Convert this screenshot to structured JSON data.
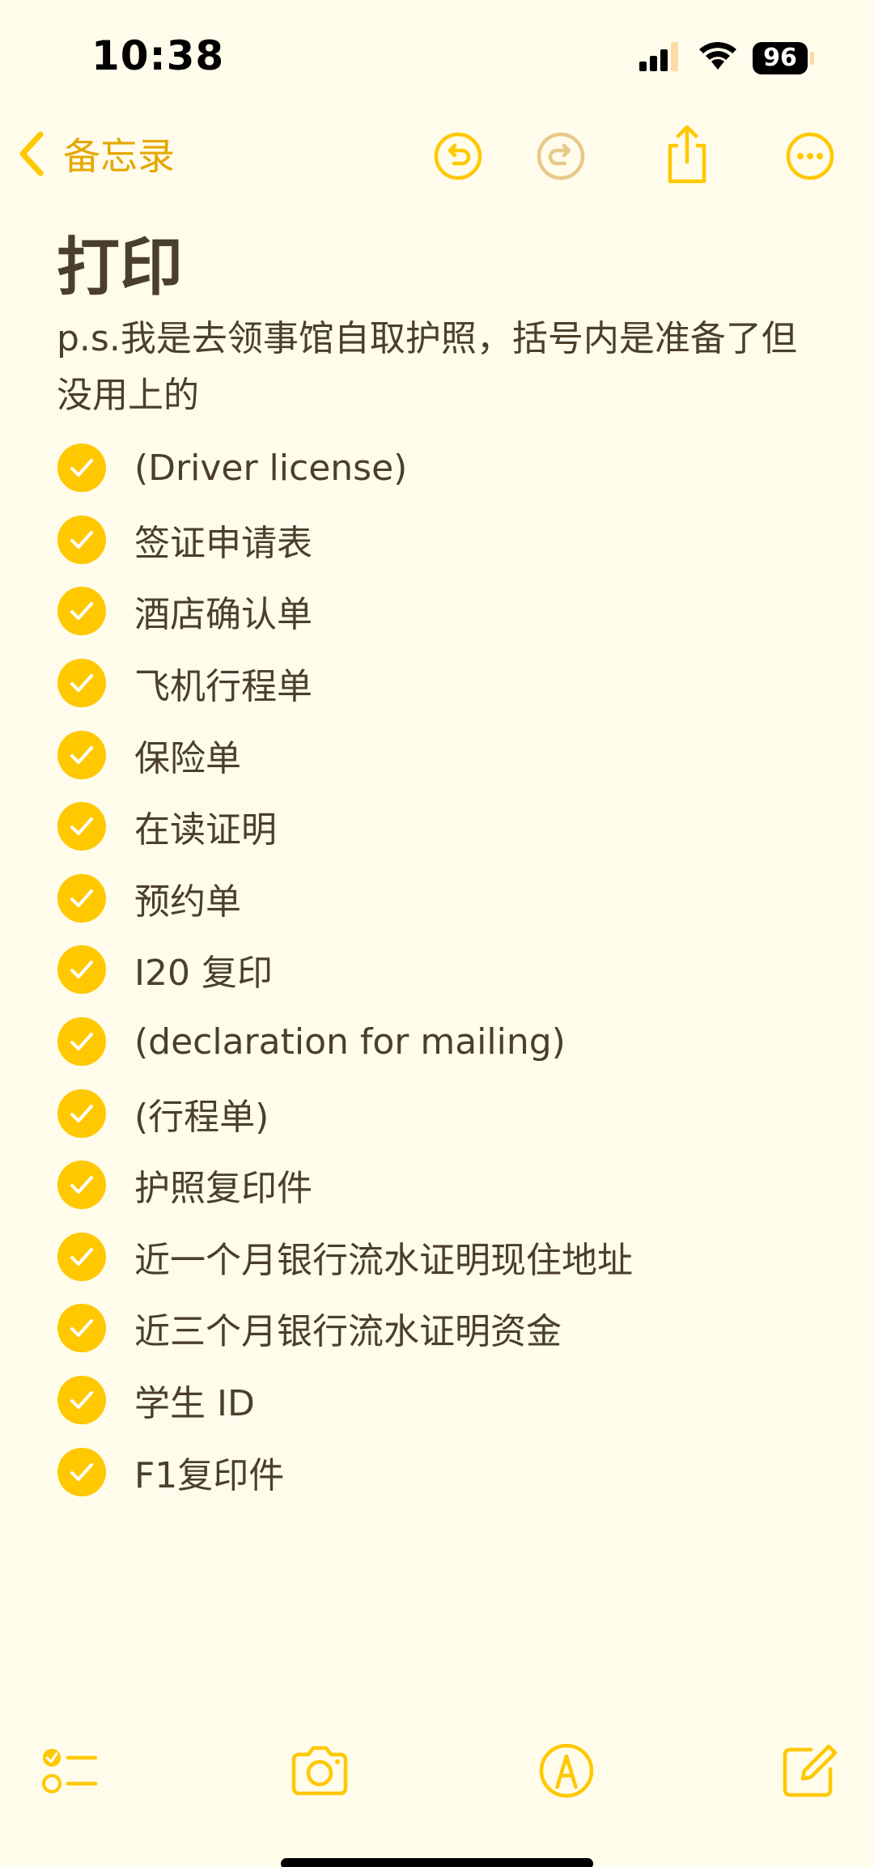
{
  "status_bar": {
    "time": "10:38",
    "battery": "96",
    "icons": [
      "signal-icon",
      "wifi-icon",
      "battery-icon"
    ]
  },
  "nav": {
    "back_label": "备忘录",
    "icons": [
      "chevron-left-icon",
      "undo-icon",
      "redo-icon",
      "share-icon",
      "more-icon"
    ]
  },
  "note": {
    "title": "打印",
    "description": "p.s.我是去领事馆自取护照，括号内是准备了但没用上的",
    "items": [
      {
        "text": "(Driver license)",
        "checked": true
      },
      {
        "text": "签证申请表",
        "checked": true
      },
      {
        "text": "酒店确认单",
        "checked": true
      },
      {
        "text": "飞机行程单",
        "checked": true
      },
      {
        "text": "保险单",
        "checked": true
      },
      {
        "text": "在读证明",
        "checked": true
      },
      {
        "text": "预约单",
        "checked": true
      },
      {
        "text": "I20 复印",
        "checked": true
      },
      {
        "text": "(declaration for mailing)",
        "checked": true
      },
      {
        "text": "(行程单)",
        "checked": true
      },
      {
        "text": "护照复印件",
        "checked": true
      },
      {
        "text": "近一个月银行流水证明现住地址",
        "checked": true
      },
      {
        "text": "近三个月银行流水证明资金",
        "checked": true
      },
      {
        "text": "学生 ID",
        "checked": true
      },
      {
        "text": "F1复印件",
        "checked": true
      }
    ]
  },
  "toolbar": {
    "icons": [
      "checklist-icon",
      "camera-icon",
      "markup-icon",
      "compose-icon"
    ]
  },
  "colors": {
    "accent": "#FFC800",
    "accent_text": "#E6A700",
    "text": "#4A3F2C",
    "background": "#FFFCEB",
    "disabled": "#E8C98A"
  }
}
